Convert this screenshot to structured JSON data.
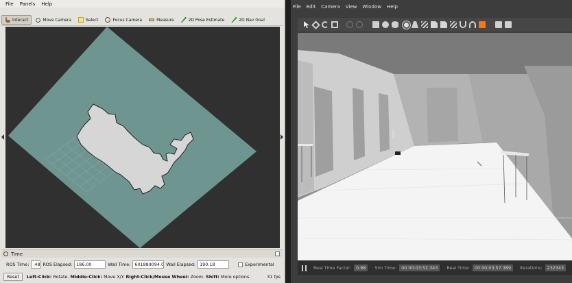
{
  "rviz": {
    "menu": [
      "File",
      "Panels",
      "Help"
    ],
    "toolbar": [
      {
        "label": "Interact",
        "icon": "interact-icon",
        "active": true
      },
      {
        "label": "Move Camera",
        "icon": "move-camera-icon"
      },
      {
        "label": "Select",
        "icon": "select-icon"
      },
      {
        "label": "Focus Camera",
        "icon": "focus-camera-icon"
      },
      {
        "label": "Measure",
        "icon": "measure-icon"
      },
      {
        "label": "2D Pose Estimate",
        "icon": "pose-estimate-icon"
      },
      {
        "label": "2D Nav Goal",
        "icon": "nav-goal-icon"
      }
    ],
    "time_panel": {
      "title": "Time",
      "ros_time_label": "ROS Time:",
      "ros_time_value": ".48",
      "ros_elapsed_label": "ROS Elapsed:",
      "ros_elapsed_value": "186.00",
      "wall_time_label": "Wall Time:",
      "wall_time_value": "601889094.00",
      "wall_elapsed_label": "Wall Elapsed:",
      "wall_elapsed_value": "190.18",
      "experimental_label": "Experimental"
    },
    "status": {
      "reset_label": "Reset",
      "left_click": "Left-Click:",
      "left_click_desc": "Rotate.",
      "middle_click": "Middle-Click:",
      "middle_click_desc": "Move X/Y.",
      "right_click": "Right-Click/Mouse Wheel:",
      "right_click_desc": "Zoom.",
      "shift": "Shift:",
      "shift_desc": "More options.",
      "fps": "31 fps"
    },
    "colors": {
      "costmap": "#6f9590",
      "map": "#d8d8d8",
      "background": "#303030"
    }
  },
  "gazebo": {
    "menu": [
      "File",
      "Edit",
      "Camera",
      "View",
      "Window",
      "Help"
    ],
    "toolbar_icons": [
      "select-arrow-icon",
      "translate-icon",
      "rotate-icon",
      "scale-icon",
      "undo-icon",
      "redo-icon",
      "box-icon",
      "sphere-icon",
      "cylinder-icon",
      "point-light-icon",
      "spot-light-icon",
      "directional-light-icon",
      "copy-icon",
      "paste-icon",
      "align-icon",
      "snap-icon",
      "headphones-icon",
      "orange-view-icon",
      "screenshot-icon",
      "record-icon"
    ],
    "bottom_bar": {
      "real_time_factor_label": "Real Time Factor:",
      "real_time_factor_value": "0.98",
      "sim_time_label": "Sim Time:",
      "sim_time_value": "00 00:03:52.343",
      "real_time_label": "Real Time:",
      "real_time_value": "00 00:03:57.389",
      "iterations_label": "Iterations:",
      "iterations_value": "232343"
    }
  }
}
